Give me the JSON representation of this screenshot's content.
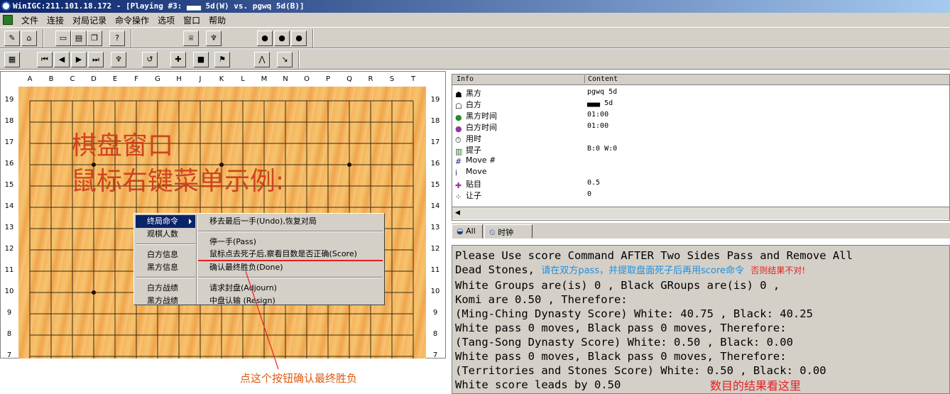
{
  "window": {
    "title": "WinIGC:211.101.18.172 - [Playing #3: ▄▄▄ 5d(W) vs. pgwq 5d(B)]"
  },
  "menu": [
    "文件",
    "连接",
    "对局记录",
    "命令操作",
    "选项",
    "窗口",
    "帮助"
  ],
  "board": {
    "columns": [
      "A",
      "B",
      "C",
      "D",
      "E",
      "F",
      "G",
      "H",
      "J",
      "K",
      "L",
      "M",
      "N",
      "O",
      "P",
      "Q",
      "R",
      "S",
      "T"
    ],
    "rows": [
      "19",
      "18",
      "17",
      "16",
      "15",
      "14",
      "13",
      "12",
      "11",
      "10",
      "9",
      "8",
      "7"
    ],
    "watermark_line1": "棋盘窗口",
    "watermark_line2": "鼠标右键菜单示例:"
  },
  "context_menu": {
    "left": [
      "终局命令",
      "观棋人数",
      "白方信息",
      "黑方信息",
      "白方战绩",
      "黑方战绩"
    ],
    "right": [
      "移去最后一手(Undo),恢复对局",
      "停一手(Pass)",
      "鼠标点去死子后,察看目数是否正确(Score)",
      "确认最终胜负(Done)",
      "请求封盘(Adjourn)",
      "中盘认输 (Resign)"
    ]
  },
  "info": {
    "headers": [
      "Info",
      "Content"
    ],
    "rows": [
      {
        "k": "黑方",
        "v": "pgwq 5d",
        "icon": "black-player-icon"
      },
      {
        "k": "白方",
        "v": "▄▄▄ 5d",
        "icon": "white-player-icon"
      },
      {
        "k": "黑方时间",
        "v": "01:00",
        "icon": "black-clock-icon"
      },
      {
        "k": "白方时间",
        "v": "01:00",
        "icon": "white-clock-icon"
      },
      {
        "k": "用时",
        "v": "",
        "icon": "timer-icon"
      },
      {
        "k": "提子",
        "v": "B:0 W:0",
        "icon": "captures-icon"
      },
      {
        "k": "Move #",
        "v": "",
        "icon": "hash-icon"
      },
      {
        "k": "Move",
        "v": "",
        "icon": "info-icon"
      },
      {
        "k": "贴目",
        "v": "0.5",
        "icon": "komi-icon"
      },
      {
        "k": "让子",
        "v": "0",
        "icon": "handicap-icon"
      }
    ]
  },
  "tabs": [
    "All",
    "时钟"
  ],
  "log": {
    "l1": "Please Use score Command AFTER Two Sides Pass and Remove All",
    "l2a": "Dead Stones, ",
    "l2b": "请在双方pass，并提取盘面死子后再用score命令",
    "l2c": "否则结果不对!",
    "l3": "White Groups are(is) 0 , Black GRoups are(is) 0 ,",
    "l4": "Komi are 0.50 , Therefore:",
    "l5": "(Ming-Ching Dynasty Score) White: 40.75 , Black: 40.25",
    "l6": "White pass 0 moves, Black pass 0 moves, Therefore:",
    "l7": "(Tang-Song Dynasty Score) White: 0.50 , Black: 0.00",
    "l8": "White pass 0 moves, Black pass 0 moves, Therefore:",
    "l9": "(Territories and Stones Score) White: 0.50 , Black: 0.00",
    "l10": "White score leads by 0.50"
  },
  "annotations": {
    "done_hint": "点这个按钮确认最终胜负",
    "result_hint": "数目的结果看这里"
  }
}
